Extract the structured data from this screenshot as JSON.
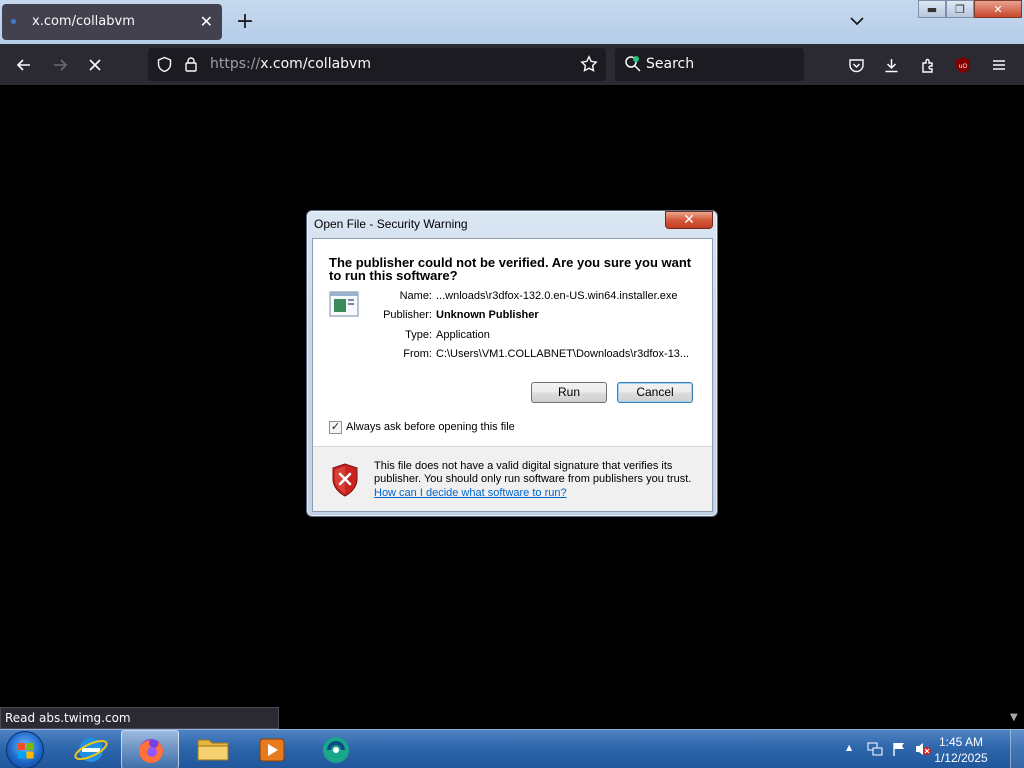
{
  "browser": {
    "tab": {
      "title": "x.com/collabvm",
      "close_glyph": "✕"
    },
    "new_tab_glyph": "+",
    "window_controls": {
      "minimize": "▬",
      "restore": "❐",
      "close": "✕"
    },
    "url": {
      "scheme": "https://",
      "host": "x.com/collabvm"
    },
    "search_placeholder": "Search",
    "status_text": "Read abs.twimg.com"
  },
  "dialog": {
    "title": "Open File - Security Warning",
    "close_glyph": "✕",
    "headline": "The publisher could not be verified.  Are you sure you want to run this software?",
    "fields": [
      {
        "label": "Name:",
        "value": "...wnloads\\r3dfox-132.0.en-US.win64.installer.exe",
        "bold": false
      },
      {
        "label": "Publisher:",
        "value": "Unknown Publisher",
        "bold": true
      },
      {
        "label": "Type:",
        "value": "Application",
        "bold": false
      },
      {
        "label": "From:",
        "value": "C:\\Users\\VM1.COLLABNET\\Downloads\\r3dfox-13...",
        "bold": false
      }
    ],
    "run_label": "Run",
    "cancel_label": "Cancel",
    "checkbox": {
      "label": "Always ask before opening this file",
      "checked": true,
      "mark": "✓"
    },
    "warning_text": "This file does not have a valid digital signature that verifies its publisher.  You should only run software from publishers you trust.",
    "help_link": "How can I decide what software to run?"
  },
  "taskbar": {
    "items": [
      "start-orb",
      "internet-explorer",
      "firefox",
      "file-explorer",
      "media-player",
      "collabvm"
    ],
    "tray_arrow": "▲",
    "clock": {
      "time": "1:45 AM",
      "date": "1/12/2025"
    }
  },
  "colors": {
    "toolbar": "#2b2a33",
    "urlbar": "#1c1b22",
    "link": "#0066cc",
    "taskbar": "#2f67ad"
  }
}
